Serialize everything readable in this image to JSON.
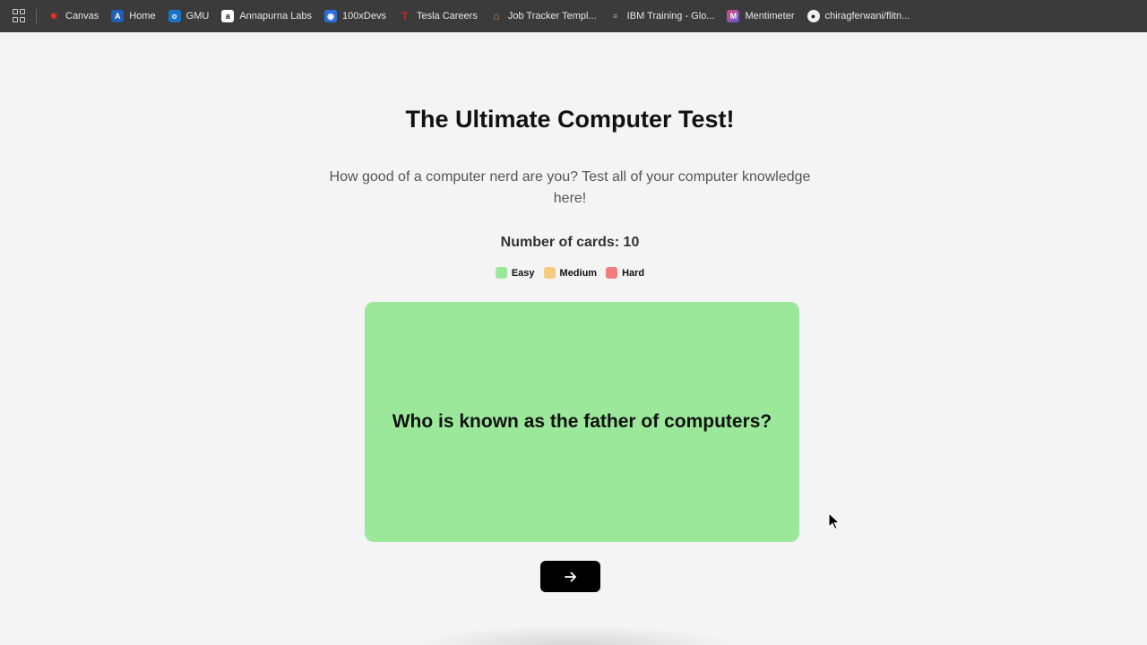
{
  "bookmarks": [
    {
      "label": "Canvas",
      "icon": "canvas-icon",
      "color": "#e0301e",
      "glyph": "✺"
    },
    {
      "label": "Home",
      "icon": "home-icon",
      "color": "#1f5fb8",
      "glyph": "A"
    },
    {
      "label": "GMU",
      "icon": "outlook-icon",
      "color": "#1a73c7",
      "glyph": "o"
    },
    {
      "label": "Annapurna Labs",
      "icon": "amazon-icon",
      "color": "#ffffff",
      "glyph": "a"
    },
    {
      "label": "100xDevs",
      "icon": "devs-icon",
      "color": "#2d6fd6",
      "glyph": "◉"
    },
    {
      "label": "Tesla Careers",
      "icon": "tesla-icon",
      "color": "#cc1a1a",
      "glyph": "T"
    },
    {
      "label": "Job Tracker Templ...",
      "icon": "notion-icon",
      "color": "#b07048",
      "glyph": "⌂"
    },
    {
      "label": "IBM Training - Glo...",
      "icon": "ibm-icon",
      "color": "#3b3b3b",
      "glyph": "≡"
    },
    {
      "label": "Mentimeter",
      "icon": "mentimeter-icon",
      "color": "#5b5bd6",
      "glyph": "M"
    },
    {
      "label": "chiragferwani/flitn...",
      "icon": "github-icon",
      "color": "#3b3b3b",
      "glyph": "●"
    }
  ],
  "page": {
    "title": "The Ultimate Computer Test!",
    "subtitle": "How good of a computer nerd are you? Test all of your computer knowledge here!",
    "card_count": "Number of cards: 10"
  },
  "legend": [
    {
      "label": "Easy",
      "color": "#9be89b"
    },
    {
      "label": "Medium",
      "color": "#f5cc80"
    },
    {
      "label": "Hard",
      "color": "#f27c7c"
    }
  ],
  "card": {
    "question": "Who is known as the father of computers?",
    "color": "#9be89b"
  },
  "next_button": {
    "icon": "arrow-right-icon"
  }
}
